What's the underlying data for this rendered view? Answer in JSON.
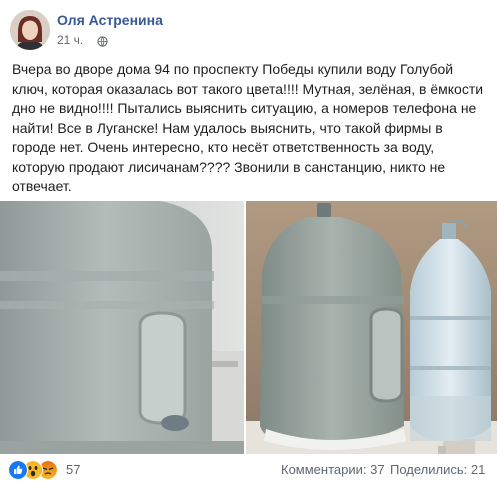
{
  "post": {
    "author": "Оля Астренина",
    "time": "21 ч.",
    "text": "Вчера во дворе дома 94 по проспекту Победы купили воду Голубой ключ, которая оказалась вот такого цвета!!!! Мутная, зелёная, в ёмкости дно не видно!!!! Пытались выяснить ситуацию, а номеров телефона не найти! Все в Луганске! Нам удалось выяснить, что такой фирмы в городе нет. Очень интересно, кто несёт ответственность за воду, которую продают лисичанам???? Звонили в санстанцию, никто не отвечает."
  },
  "footer": {
    "reactions": [
      "like-icon",
      "wow-icon",
      "angry-icon"
    ],
    "reaction_count": "57",
    "comments": "Комментарии: 37",
    "shares": "Поделились: 21"
  },
  "colors": {
    "author_link": "#385898",
    "meta_text": "#616770",
    "body_text": "#1c1e21",
    "like_blue": "#1877f2",
    "wow_yellow": "#f7b928",
    "angry_orange": "#e9710f"
  }
}
